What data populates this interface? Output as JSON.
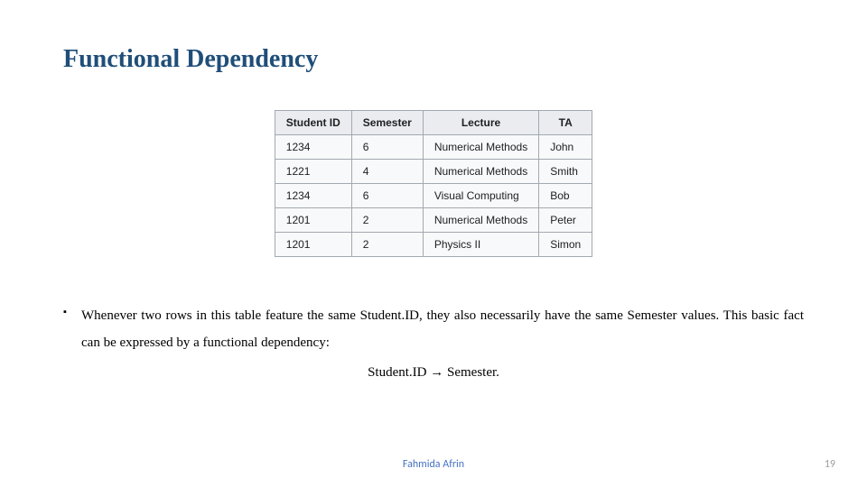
{
  "title": "Functional Dependency",
  "chart_data": {
    "type": "table",
    "columns": [
      "Student ID",
      "Semester",
      "Lecture",
      "TA"
    ],
    "rows": [
      [
        "1234",
        "6",
        "Numerical Methods",
        "John"
      ],
      [
        "1221",
        "4",
        "Numerical Methods",
        "Smith"
      ],
      [
        "1234",
        "6",
        "Visual Computing",
        "Bob"
      ],
      [
        "1201",
        "2",
        "Numerical Methods",
        "Peter"
      ],
      [
        "1201",
        "2",
        "Physics II",
        "Simon"
      ]
    ]
  },
  "bullet": "Whenever two rows in this table feature the same Student.ID, they also necessarily have the same Semester values. This basic fact can be expressed by a functional dependency:",
  "fd": "Student.ID → Semester.",
  "footer": {
    "author": "Fahmida Afrin",
    "page": "19"
  }
}
